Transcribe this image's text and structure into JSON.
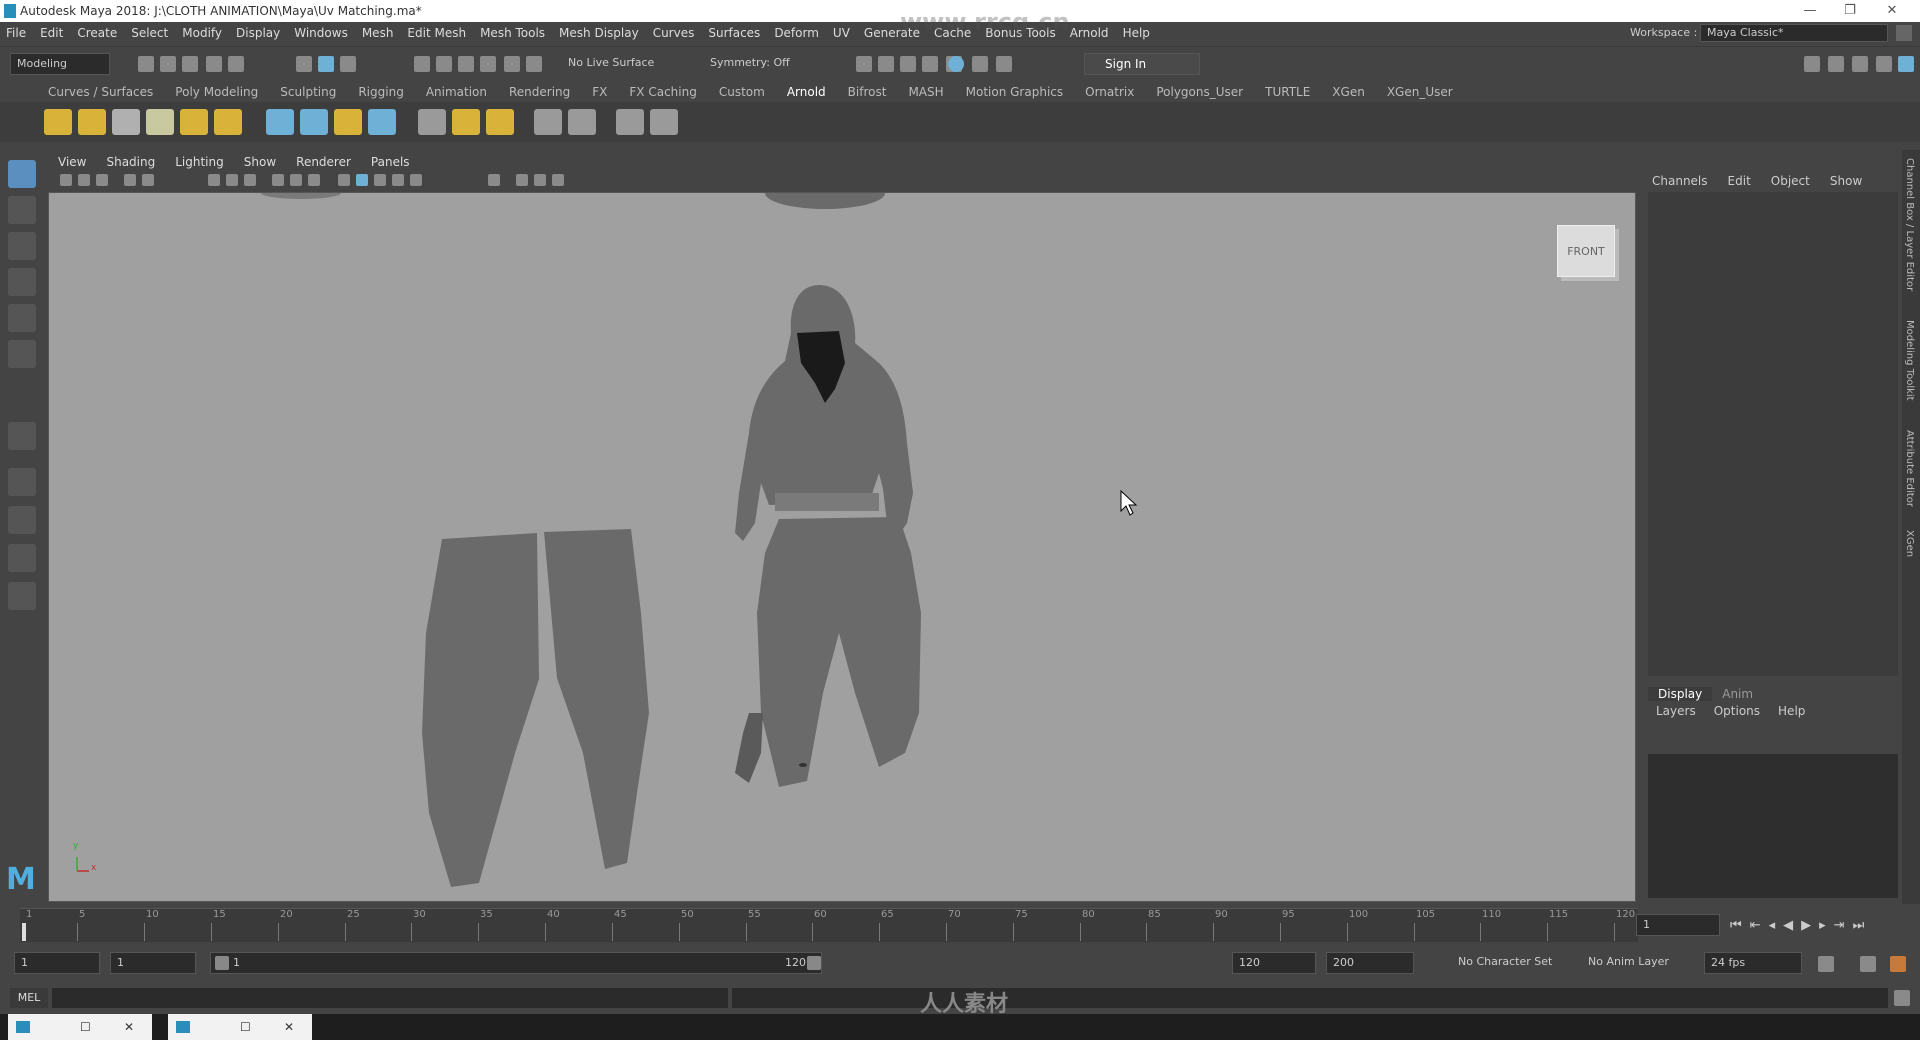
{
  "window": {
    "title": "Autodesk Maya 2018: J:\\CLOTH ANIMATION\\Maya\\Uv Matching.ma*",
    "minimize": "—",
    "restore": "❐",
    "close": "✕"
  },
  "menubar": {
    "items": [
      "File",
      "Edit",
      "Create",
      "Select",
      "Modify",
      "Display",
      "Windows",
      "Mesh",
      "Edit Mesh",
      "Mesh Tools",
      "Mesh Display",
      "Curves",
      "Surfaces",
      "Deform",
      "UV",
      "Generate",
      "Cache",
      "Bonus Tools",
      "Arnold",
      "Help"
    ],
    "workspace_label": "Workspace :",
    "workspace_value": "Maya Classic*"
  },
  "statusline": {
    "mode": "Modeling",
    "live_surface": "No Live Surface",
    "symmetry": "Symmetry: Off",
    "sign_in": "Sign In"
  },
  "shelf": {
    "tabs": [
      "Curves / Surfaces",
      "Poly Modeling",
      "Sculpting",
      "Rigging",
      "Animation",
      "Rendering",
      "FX",
      "FX Caching",
      "Custom",
      "Arnold",
      "Bifrost",
      "MASH",
      "Motion Graphics",
      "Ornatrix",
      "Polygons_User",
      "TURTLE",
      "XGen",
      "XGen_User"
    ],
    "active_tab": "Arnold"
  },
  "viewport": {
    "menu": [
      "View",
      "Shading",
      "Lighting",
      "Show",
      "Renderer",
      "Panels"
    ],
    "view_cube_label": "FRONT",
    "axis_y": "y",
    "axis_x": "x"
  },
  "channel_box": {
    "menu": [
      "Channels",
      "Edit",
      "Object",
      "Show"
    ]
  },
  "layer_editor": {
    "tabs": [
      "Display",
      "Anim"
    ],
    "menu": [
      "Layers",
      "Options",
      "Help"
    ]
  },
  "side_tabs": [
    "Channel Box / Layer Editor",
    "Modeling Toolkit",
    "Attribute Editor",
    "XGen"
  ],
  "timeline": {
    "ticks": [
      1,
      5,
      10,
      15,
      20,
      25,
      30,
      35,
      40,
      45,
      50,
      55,
      60,
      65,
      70,
      75,
      80,
      85,
      90,
      95,
      100,
      105,
      110,
      115,
      120
    ],
    "current_frame": "1"
  },
  "range": {
    "start": "1",
    "playback_start": "1",
    "slider_start": "1",
    "slider_end": "120",
    "playback_end": "120",
    "end": "200",
    "character_set": "No Character Set",
    "anim_layer": "No Anim Layer",
    "fps": "24 fps"
  },
  "commandline": {
    "label": "MEL",
    "watermark": "人人素材"
  },
  "watermark": "www.rrcg.cn"
}
